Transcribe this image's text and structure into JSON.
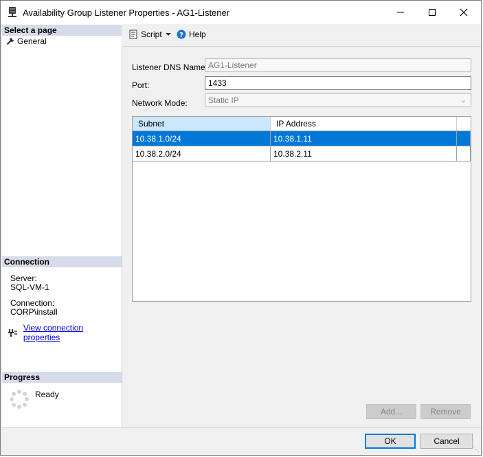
{
  "window": {
    "title": "Availability Group Listener Properties - AG1-Listener"
  },
  "sidebar": {
    "select_page_header": "Select a page",
    "pages": [
      {
        "label": "General",
        "icon": "wrench-icon"
      }
    ],
    "connection_header": "Connection",
    "server_label": "Server:",
    "server_value": "SQL-VM-1",
    "connection_label": "Connection:",
    "connection_value": "CORP\\install",
    "view_props_link": "View connection properties",
    "progress_header": "Progress",
    "progress_status": "Ready"
  },
  "toolbar": {
    "script_label": "Script",
    "help_label": "Help"
  },
  "form": {
    "dns_label": "Listener DNS Name:",
    "dns_value": "AG1-Listener",
    "port_label": "Port:",
    "port_value": "1433",
    "network_mode_label": "Network Mode:",
    "network_mode_value": "Static IP"
  },
  "grid": {
    "columns": [
      "Subnet",
      "IP Address"
    ],
    "rows": [
      {
        "subnet": "10.38.1.0/24",
        "ip": "10.38.1.11",
        "selected": true
      },
      {
        "subnet": "10.38.2.0/24",
        "ip": "10.38.2.11",
        "selected": false
      }
    ]
  },
  "buttons": {
    "add": "Add...",
    "remove": "Remove",
    "ok": "OK",
    "cancel": "Cancel"
  },
  "colors": {
    "selection": "#0078d7",
    "header_bg": "#d6dbe9",
    "link": "#0000ee"
  }
}
